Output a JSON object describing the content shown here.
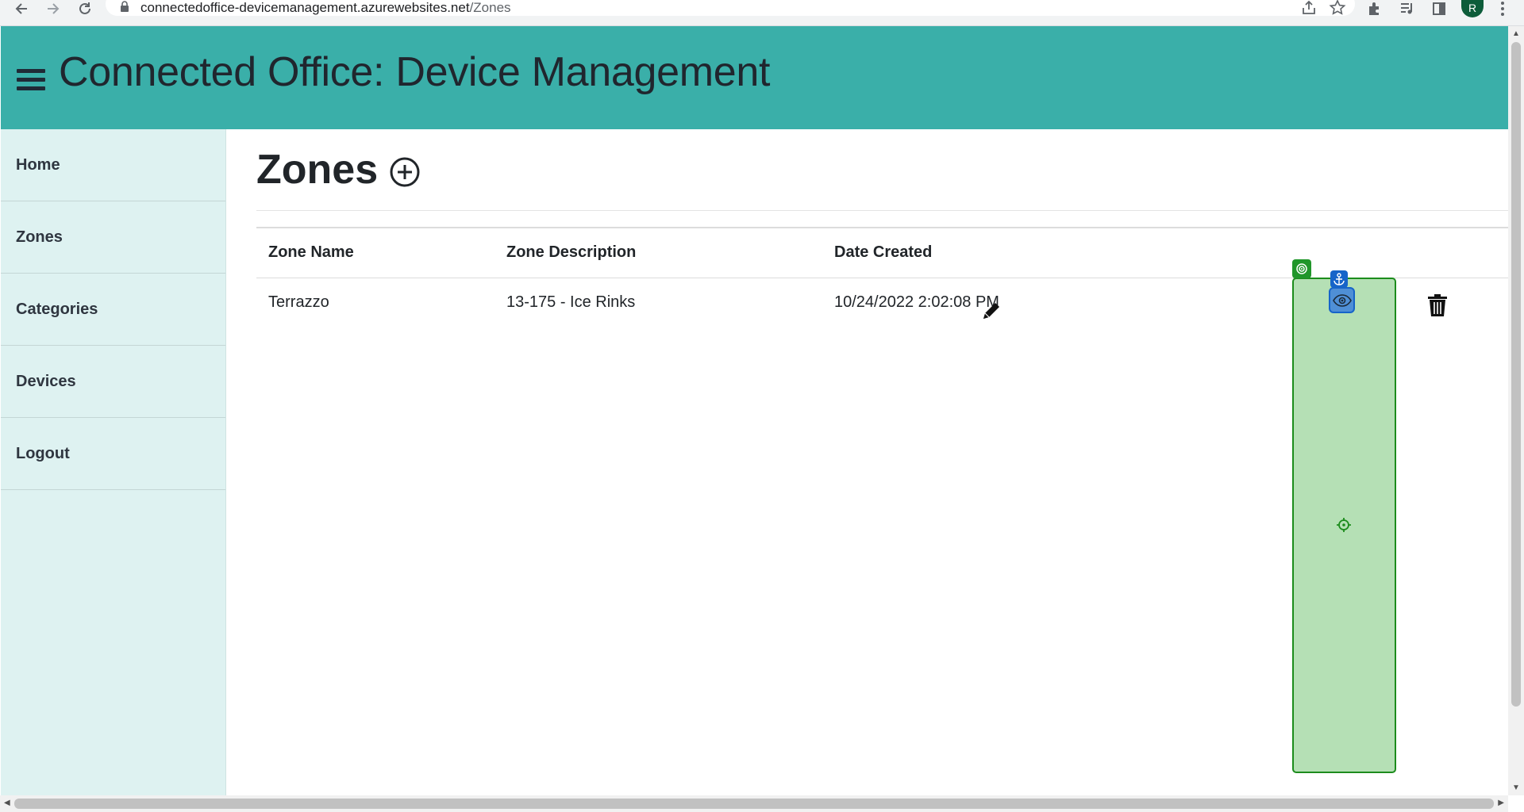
{
  "browser": {
    "url_host": "connectedoffice-devicemanagement.azurewebsites.net",
    "url_path": "/Zones",
    "profile_initial": "R"
  },
  "header": {
    "title": "Connected Office: Device Management"
  },
  "sidebar": {
    "items": [
      {
        "label": "Home"
      },
      {
        "label": "Zones"
      },
      {
        "label": "Categories"
      },
      {
        "label": "Devices"
      },
      {
        "label": "Logout"
      }
    ]
  },
  "main": {
    "title": "Zones",
    "table": {
      "headers": [
        "Zone Name",
        "Zone Description",
        "Date Created"
      ],
      "rows": [
        {
          "name": "Terrazzo",
          "description": "13-175 - Ice Rinks",
          "date_created": "10/24/2022 2:02:08 PM"
        }
      ]
    }
  },
  "colors": {
    "header_bg": "#3aafa9",
    "sidebar_bg": "#def2f1",
    "overlay_green": "#1c8c1c",
    "anchor_blue": "#1664c9"
  },
  "icons": [
    "back-icon",
    "forward-icon",
    "reload-icon",
    "lock-icon",
    "share-icon",
    "star-icon",
    "extensions-icon",
    "media-icon",
    "side-panel-icon",
    "menu-dots-icon",
    "hamburger-icon",
    "add-circle-icon",
    "pencil-icon",
    "eye-icon",
    "trash-icon",
    "target-icon",
    "anchor-icon",
    "crosshair-icon"
  ]
}
